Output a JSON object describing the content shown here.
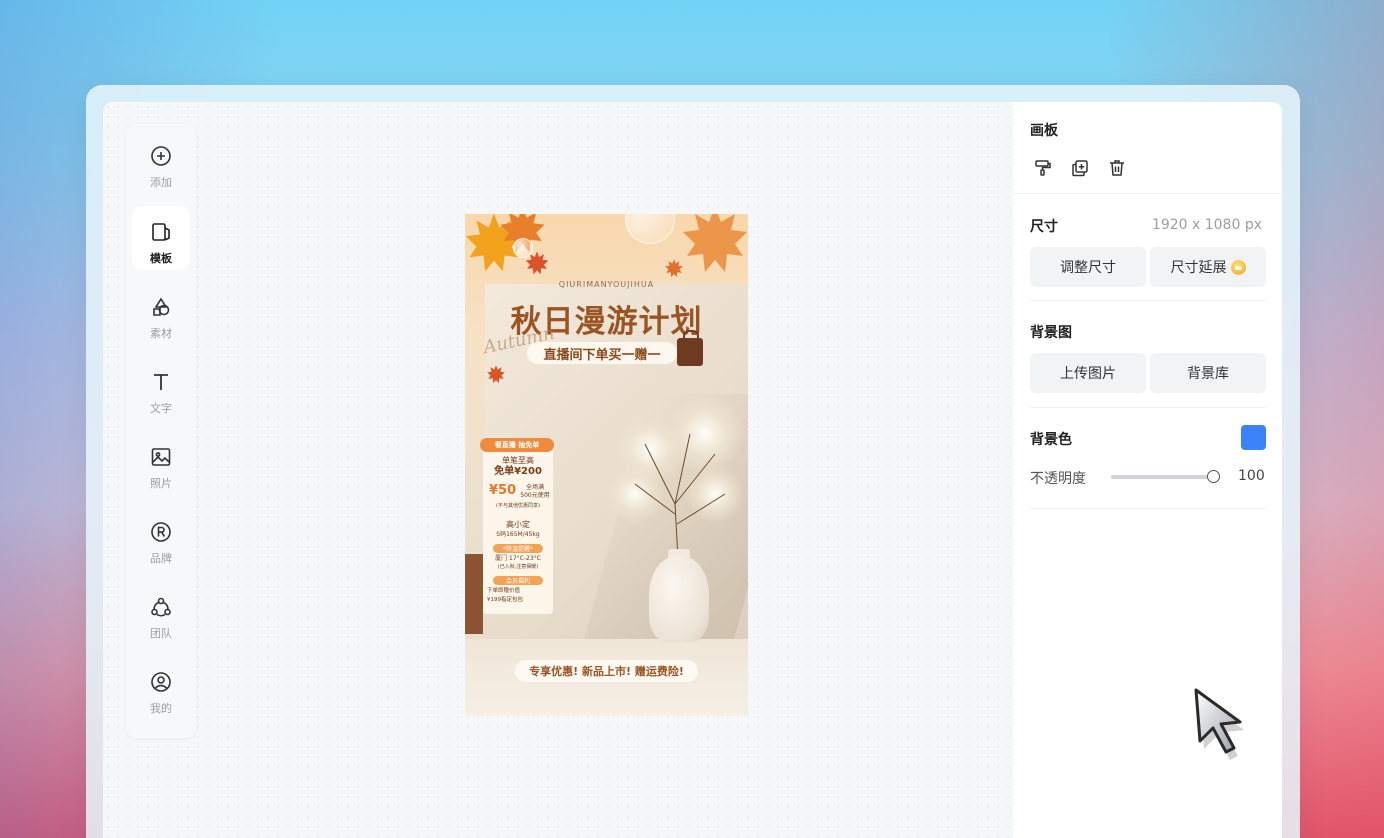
{
  "toolbar": {
    "items": [
      {
        "label": "添加",
        "icon": "plus-circle-icon"
      },
      {
        "label": "模板",
        "icon": "template-icon",
        "active": true
      },
      {
        "label": "素材",
        "icon": "shapes-icon"
      },
      {
        "label": "文字",
        "icon": "text-icon"
      },
      {
        "label": "照片",
        "icon": "image-icon"
      },
      {
        "label": "品牌",
        "icon": "registered-icon"
      },
      {
        "label": "团队",
        "icon": "team-icon"
      },
      {
        "label": "我的",
        "icon": "user-circle-icon"
      }
    ]
  },
  "poster": {
    "subtitle_en": "QIURIMANYOUJIHUA",
    "title": "秋日漫游计划",
    "script": "Autumn",
    "pill": "直播间下单买一赠一",
    "card": {
      "tag": "看直播 抽免单",
      "line1": "单笔至高",
      "line2": "免单¥200",
      "coupon": "¥50",
      "coupon_note": "全场满",
      "coupon_note2": "500元使用",
      "coupon_note3": "(不与其他优惠同享)",
      "model_title": "高小定",
      "model_spec": "S码165M/45kg",
      "weather_tag": "*降温提醒*",
      "weather": "厦门 17°C-23°C",
      "weather_note": "(已入秋,注意保暖)",
      "gift_tag": "会员福利",
      "gift1": "下单即赠价值",
      "gift2": "¥199指定包包"
    },
    "bottom": "专享优惠! 新品上市! 赠运费险!"
  },
  "panel": {
    "title": "画板",
    "icons": [
      "format-painter-icon",
      "duplicate-icon",
      "trash-icon"
    ],
    "size_label": "尺寸",
    "size_value": "1920 x 1080 px",
    "resize_button": "调整尺寸",
    "extend_button": "尺寸延展",
    "bg_image_label": "背景图",
    "upload_button": "上传图片",
    "library_button": "背景库",
    "bg_color_label": "背景色",
    "bg_color": "#3b82f6",
    "opacity_label": "不透明度",
    "opacity_value": "100",
    "opacity_level": 1.0
  }
}
